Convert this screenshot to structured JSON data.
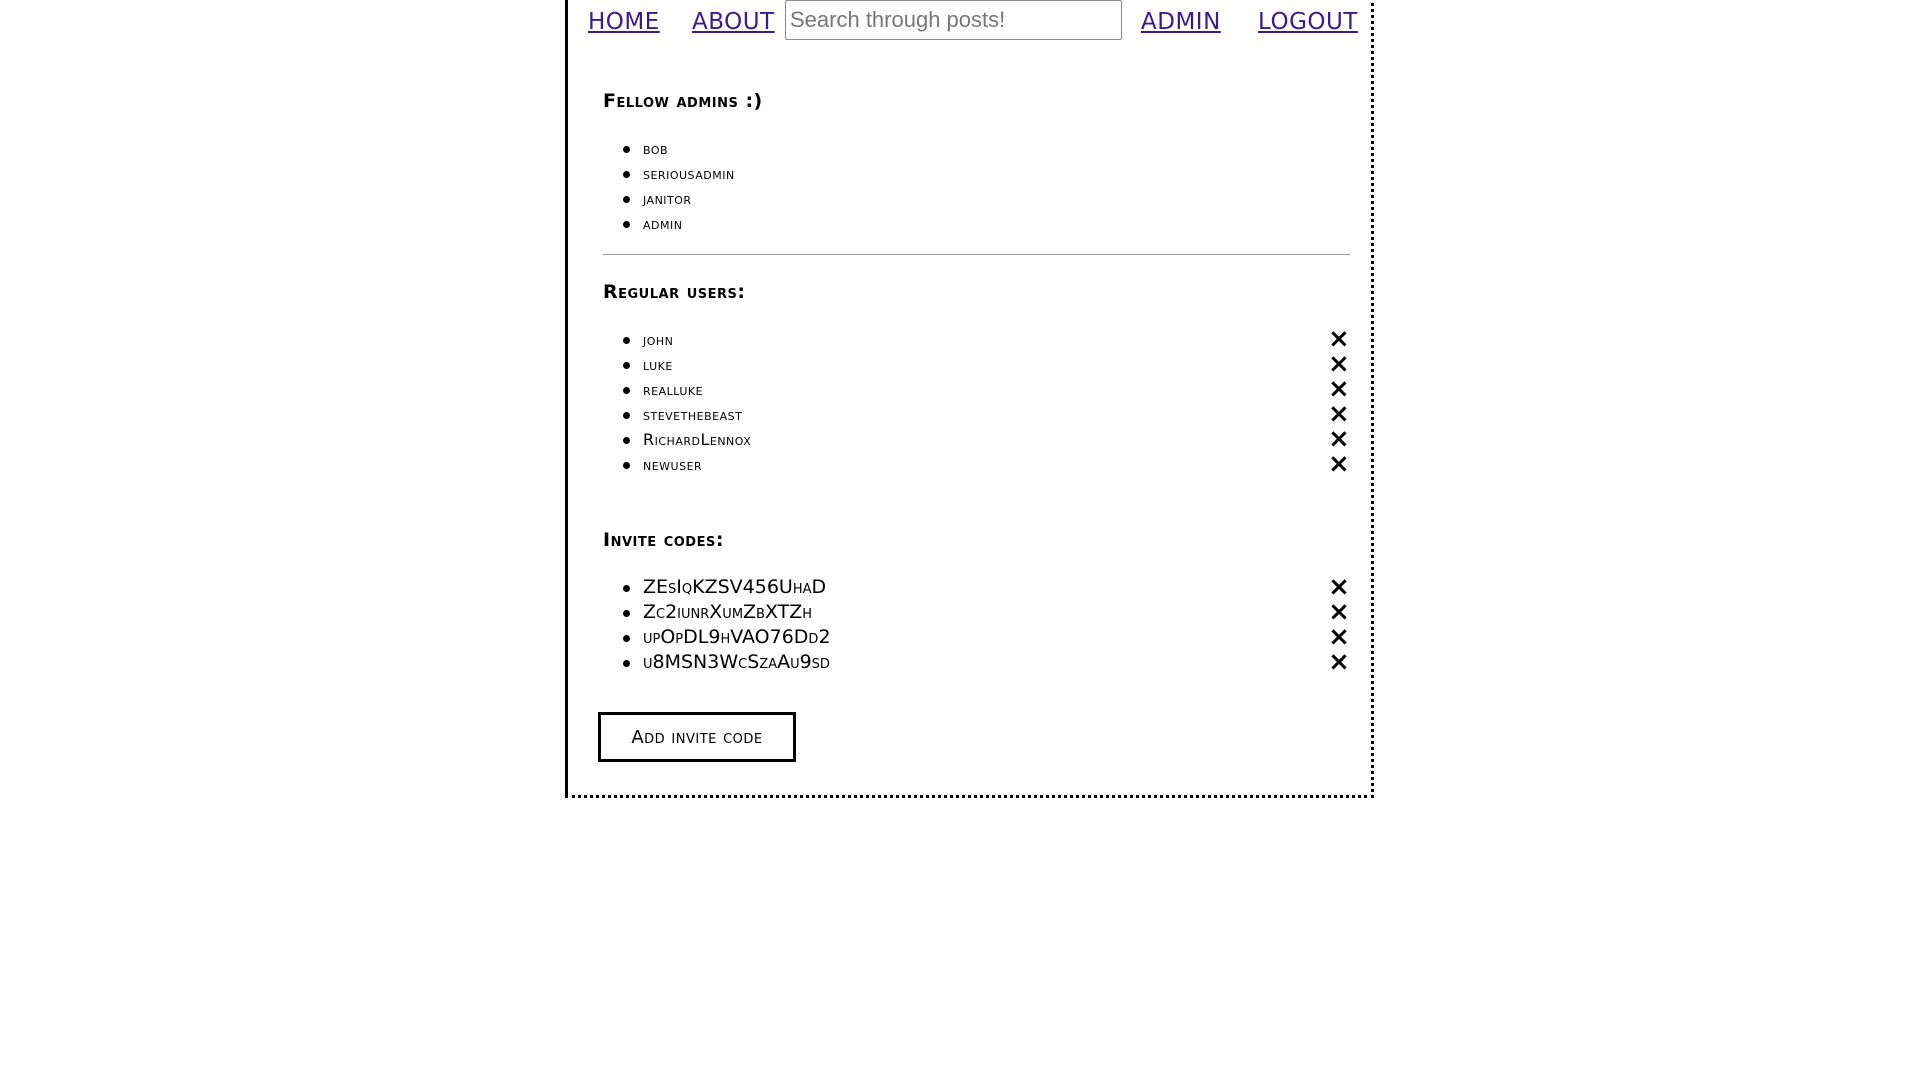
{
  "nav": {
    "home": "HOME",
    "about": "ABOUT",
    "search_placeholder": "Search through posts!",
    "admin": "ADMIN",
    "logout": "LOGOUT"
  },
  "admins": {
    "title": "Fellow admins :)",
    "items": [
      "bob",
      "seriousadmin",
      "janitor",
      "admin"
    ]
  },
  "users": {
    "title": "Regular users:",
    "items": [
      "john",
      "luke",
      "realluke",
      "stevethebeast",
      "RichardLennox",
      "newuser"
    ],
    "remove_icon": "×"
  },
  "invite_codes": {
    "title": "Invite codes:",
    "items": [
      "ZEsIqKZSV456UhaD",
      "Zc2iunrXumZbXTZh",
      "upOpDL9hVAO76Dd2",
      "u8MSN3WcSzaAu9sd"
    ],
    "remove_icon": "×"
  },
  "add_invite_button": "Add invite code"
}
